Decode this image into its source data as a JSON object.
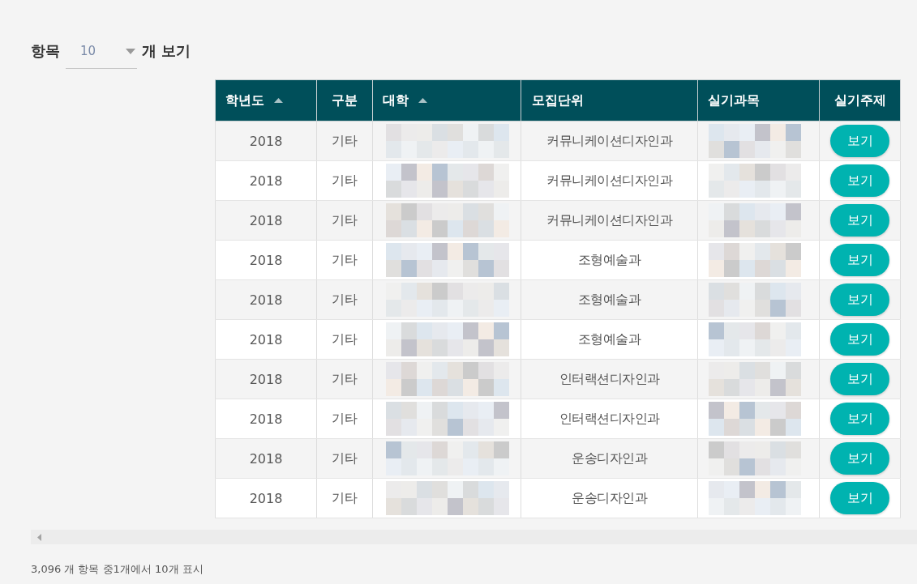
{
  "length_control": {
    "label_before": "항목",
    "value": "10",
    "label_after": "개 보기"
  },
  "table": {
    "columns": [
      {
        "label": "학년도",
        "sorted": true
      },
      {
        "label": "구분",
        "sorted": false
      },
      {
        "label": "대학",
        "sorted": true
      },
      {
        "label": "모집단위",
        "sorted": false
      },
      {
        "label": "실기과목",
        "sorted": false
      },
      {
        "label": "실기주제",
        "sorted": false
      }
    ],
    "rows": [
      {
        "year": "2018",
        "type": "기타",
        "unit": "커뮤니케이션디자인과",
        "action": "보기"
      },
      {
        "year": "2018",
        "type": "기타",
        "unit": "커뮤니케이션디자인과",
        "action": "보기"
      },
      {
        "year": "2018",
        "type": "기타",
        "unit": "커뮤니케이션디자인과",
        "action": "보기"
      },
      {
        "year": "2018",
        "type": "기타",
        "unit": "조형예술과",
        "action": "보기"
      },
      {
        "year": "2018",
        "type": "기타",
        "unit": "조형예술과",
        "action": "보기"
      },
      {
        "year": "2018",
        "type": "기타",
        "unit": "조형예술과",
        "action": "보기"
      },
      {
        "year": "2018",
        "type": "기타",
        "unit": "인터랙션디자인과",
        "action": "보기"
      },
      {
        "year": "2018",
        "type": "기타",
        "unit": "인터랙션디자인과",
        "action": "보기"
      },
      {
        "year": "2018",
        "type": "기타",
        "unit": "운송디자인과",
        "action": "보기"
      },
      {
        "year": "2018",
        "type": "기타",
        "unit": "운송디자인과",
        "action": "보기"
      }
    ]
  },
  "info": "3,096 개 항목 중1개에서 10개 표시"
}
